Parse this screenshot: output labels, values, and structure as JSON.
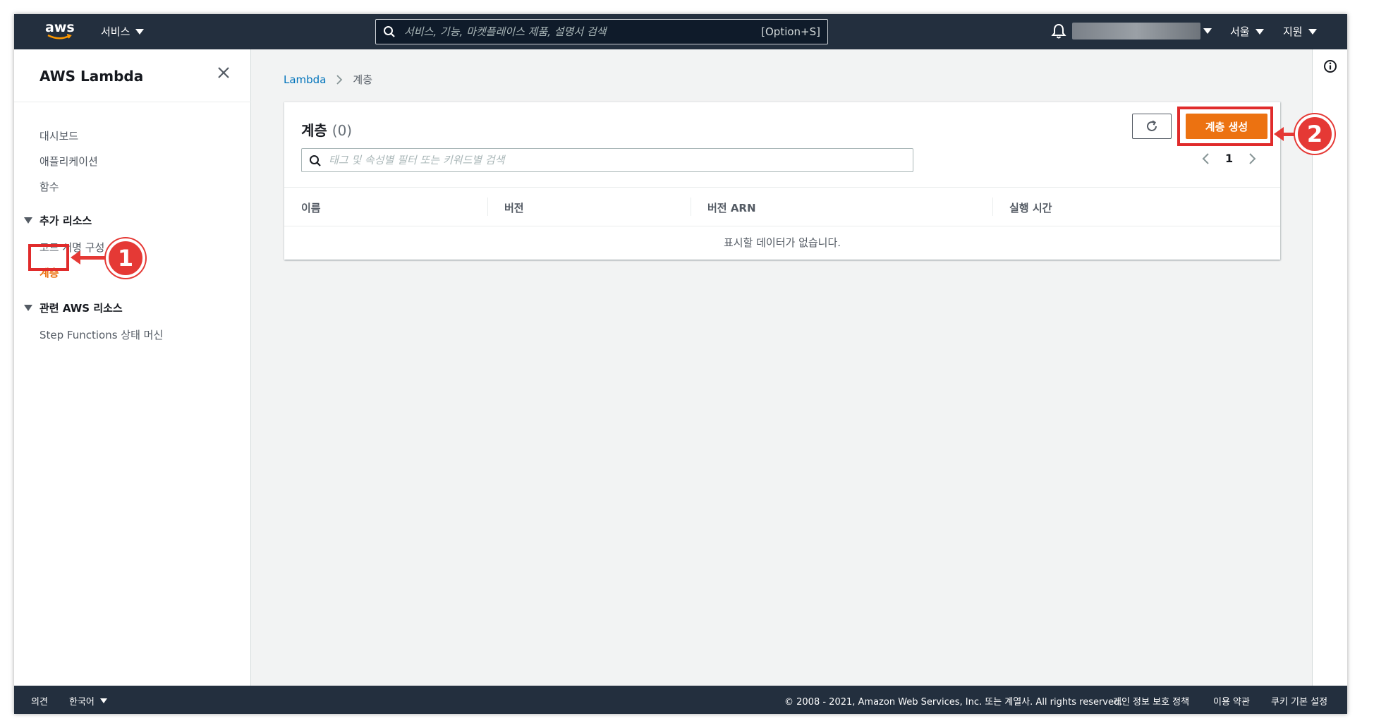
{
  "topnav": {
    "logo_text": "aws",
    "services_label": "서비스",
    "search_placeholder": "서비스, 기능, 마켓플레이스 제품, 설명서 검색",
    "search_shortcut": "[Option+S]",
    "region_label": "서울",
    "support_label": "지원"
  },
  "sidebar": {
    "title": "AWS Lambda",
    "items": [
      {
        "label": "대시보드"
      },
      {
        "label": "애플리케이션"
      },
      {
        "label": "함수"
      }
    ],
    "sections": [
      {
        "label": "추가 리소스",
        "items": [
          {
            "label": "코드 서명 구성"
          },
          {
            "label": "계층",
            "active": true
          }
        ]
      },
      {
        "label": "관련 AWS 리소스",
        "items": [
          {
            "label": "Step Functions 상태 머신"
          }
        ]
      }
    ]
  },
  "breadcrumb": {
    "root": "Lambda",
    "current": "계층"
  },
  "panel": {
    "title": "계층",
    "count": "(0)",
    "create_button": "계층 생성",
    "filter_placeholder": "태그 및 속성별 필터 또는 키워드별 검색",
    "page_number": "1",
    "columns": [
      "이름",
      "버전",
      "버전 ARN",
      "실행 시간"
    ],
    "empty_message": "표시할 데이터가 없습니다."
  },
  "annotations": {
    "marker1": "1",
    "marker2": "2"
  },
  "footer": {
    "feedback": "의견",
    "language": "한국어",
    "copyright": "© 2008 - 2021, Amazon Web Services, Inc. 또는 계열사. All rights reserved.",
    "privacy": "개인 정보 보호 정책",
    "terms": "이용 약관",
    "cookies": "쿠키 기본 설정"
  },
  "colors": {
    "nav_bg": "#232f3e",
    "accent": "#ec7211",
    "link": "#0073bb",
    "annotation": "#e53935"
  },
  "icons": [
    "search-icon",
    "bell-icon",
    "close-icon",
    "refresh-icon",
    "info-icon",
    "chevron-left-icon",
    "chevron-right-icon"
  ]
}
